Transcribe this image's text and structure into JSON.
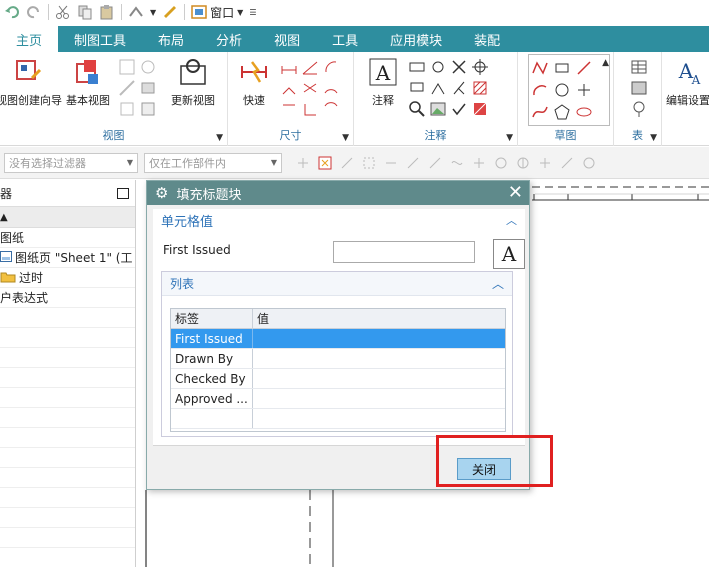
{
  "qat": {
    "window_label": "窗口"
  },
  "tabs": [
    "主页",
    "制图工具",
    "布局",
    "分析",
    "视图",
    "工具",
    "应用模块",
    "装配"
  ],
  "ribbon": {
    "view_group": {
      "label": "视图",
      "btn_view_wizard": "视图创建向导",
      "btn_base_view": "基本视图",
      "btn_update_view": "更新视图"
    },
    "dimension_group": {
      "label": "尺寸",
      "btn_quick": "快速"
    },
    "annotation_group": {
      "label": "注释",
      "btn_note": "注释"
    },
    "sketch_group": {
      "label": "草图"
    },
    "table_group": {
      "label": "表"
    },
    "edit_settings": "编辑设置"
  },
  "filterbar": {
    "selection_filter_placeholder": "没有选择过滤器",
    "scope_placeholder": "仅在工作部件内"
  },
  "navigator": {
    "title": "器",
    "rows": [
      "图纸",
      "图纸页 \"Sheet 1\" (工",
      "过时",
      "户表达式"
    ]
  },
  "dialog": {
    "title": "填充标题块",
    "section_cell_value": "单元格值",
    "field_label": "First Issued",
    "field_value": "",
    "font_button": "A",
    "list_section": "列表",
    "table": {
      "headers": [
        "标签",
        "值"
      ],
      "rows": [
        {
          "label": "First Issued",
          "value": ""
        },
        {
          "label": "Drawn By",
          "value": ""
        },
        {
          "label": "Checked By",
          "value": ""
        },
        {
          "label": "Approved ...",
          "value": ""
        }
      ]
    },
    "close_button": "关闭"
  },
  "colors": {
    "ribbon_tab_bg": "#2e8e9f",
    "dialog_title_bg": "#5f8a8b",
    "selected_row": "#3399ee",
    "highlight_box": "#e02020"
  }
}
